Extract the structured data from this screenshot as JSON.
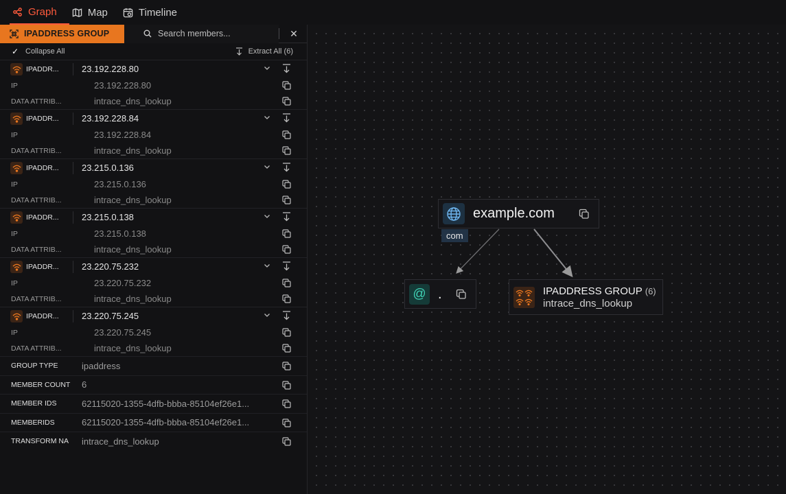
{
  "nav": {
    "tabs": [
      {
        "label": "Graph",
        "icon": "graph-icon",
        "active": true
      },
      {
        "label": "Map",
        "icon": "map-icon",
        "active": false
      },
      {
        "label": "Timeline",
        "icon": "timeline-icon",
        "active": false
      }
    ]
  },
  "sidebar": {
    "group_label": "IPADDRESS GROUP",
    "search_placeholder": "Search members...",
    "collapse_all": "Collapse All",
    "extract_all": "Extract All (6)",
    "members": [
      {
        "type": "IPADDR...",
        "value": "23.192.228.80",
        "attrs": [
          {
            "key": "IP",
            "value": "23.192.228.80"
          },
          {
            "key": "DATA ATTRIB...",
            "value": "intrace_dns_lookup"
          }
        ]
      },
      {
        "type": "IPADDR...",
        "value": "23.192.228.84",
        "attrs": [
          {
            "key": "IP",
            "value": "23.192.228.84"
          },
          {
            "key": "DATA ATTRIB...",
            "value": "intrace_dns_lookup"
          }
        ]
      },
      {
        "type": "IPADDR...",
        "value": "23.215.0.136",
        "attrs": [
          {
            "key": "IP",
            "value": "23.215.0.136"
          },
          {
            "key": "DATA ATTRIB...",
            "value": "intrace_dns_lookup"
          }
        ]
      },
      {
        "type": "IPADDR...",
        "value": "23.215.0.138",
        "attrs": [
          {
            "key": "IP",
            "value": "23.215.0.138"
          },
          {
            "key": "DATA ATTRIB...",
            "value": "intrace_dns_lookup"
          }
        ]
      },
      {
        "type": "IPADDR...",
        "value": "23.220.75.232",
        "attrs": [
          {
            "key": "IP",
            "value": "23.220.75.232"
          },
          {
            "key": "DATA ATTRIB...",
            "value": "intrace_dns_lookup"
          }
        ]
      },
      {
        "type": "IPADDR...",
        "value": "23.220.75.245",
        "attrs": [
          {
            "key": "IP",
            "value": "23.220.75.245"
          },
          {
            "key": "DATA ATTRIB...",
            "value": "intrace_dns_lookup"
          }
        ]
      }
    ],
    "properties": [
      {
        "key": "GROUP TYPE",
        "value": "ipaddress"
      },
      {
        "key": "MEMBER COUNT",
        "value": "6"
      },
      {
        "key": "MEMBER IDS",
        "value": "62115020-1355-4dfb-bbba-85104ef26e1..."
      },
      {
        "key": "MEMBERIDS",
        "value": "62115020-1355-4dfb-bbba-85104ef26e1..."
      },
      {
        "key": "TRANSFORM NA",
        "value": "intrace_dns_lookup"
      }
    ]
  },
  "graph": {
    "domain_node": {
      "label": "example.com",
      "tld": "com"
    },
    "at_node": {
      "label": "."
    },
    "group_node": {
      "title": "IPADDRESS GROUP",
      "count": "(6)",
      "subtitle": "intrace_dns_lookup"
    }
  },
  "colors": {
    "accent": "#e8761f",
    "active_tab": "#ff5a3c",
    "wifi_icon": "#e8761f",
    "email_icon": "#3fd1b4"
  }
}
